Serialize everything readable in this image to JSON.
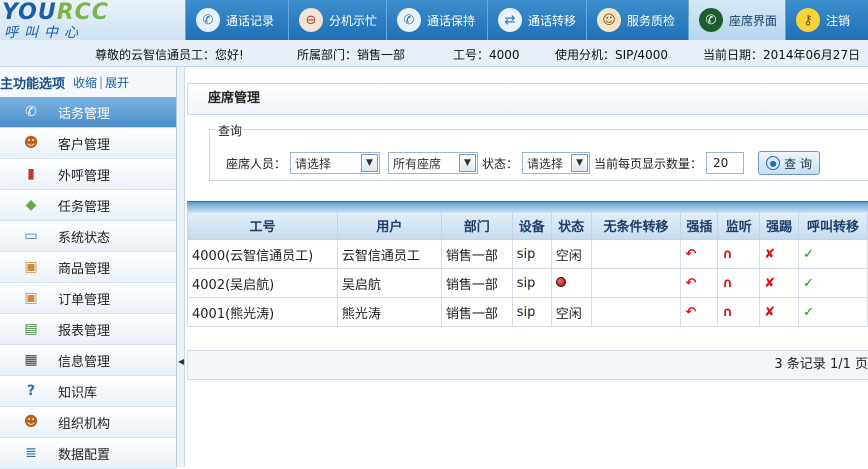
{
  "logo": {
    "text_main": "YOU",
    "text_rcc": "RCC",
    "text_sub": "呼叫中心"
  },
  "topnav": [
    {
      "label": "通话记录",
      "icon": "phone-icon"
    },
    {
      "label": "分机示忙",
      "icon": "busy-icon"
    },
    {
      "label": "通话保持",
      "icon": "hold-icon"
    },
    {
      "label": "通话转移",
      "icon": "transfer-icon"
    },
    {
      "label": "服务质检",
      "icon": "quality-icon"
    },
    {
      "label": "座席界面",
      "icon": "seat-icon"
    },
    {
      "label": "注销",
      "icon": "key-icon"
    }
  ],
  "infobar": {
    "greeting": "尊敬的云智信通员工：您好!",
    "dept": "所属部门：销售一部",
    "jobno": "工号：4000",
    "ext": "使用分机：SIP/4000",
    "date": "当前日期：2014年06月27日"
  },
  "sidebar": {
    "title": "主功能选项",
    "collapse": "收缩",
    "sep": "|",
    "expand": "展开",
    "items": [
      {
        "label": "话务管理",
        "icon": "phone-icon"
      },
      {
        "label": "客户管理",
        "icon": "customer-icon"
      },
      {
        "label": "外呼管理",
        "icon": "books-icon"
      },
      {
        "label": "任务管理",
        "icon": "task-icon"
      },
      {
        "label": "系统状态",
        "icon": "monitor-icon"
      },
      {
        "label": "商品管理",
        "icon": "box-icon"
      },
      {
        "label": "订单管理",
        "icon": "order-icon"
      },
      {
        "label": "报表管理",
        "icon": "report-icon"
      },
      {
        "label": "信息管理",
        "icon": "info-icon"
      },
      {
        "label": "知识库",
        "icon": "help-icon"
      },
      {
        "label": "组织机构",
        "icon": "users-icon"
      },
      {
        "label": "数据配置",
        "icon": "database-icon"
      }
    ]
  },
  "main": {
    "title": "座席管理",
    "query": {
      "legend": "查询",
      "agent_label": "座席人员：",
      "agent_value": "请选择",
      "seat_value": "所有座席",
      "status_label": "状态：",
      "status_value": "请选择",
      "pagesize_label": "当前每页显示数量：",
      "pagesize_value": "20",
      "search_button": "查 询"
    },
    "table": {
      "headers": [
        "工号",
        "用户",
        "部门",
        "设备",
        "状态",
        "无条件转移",
        "强插",
        "监听",
        "强踢",
        "呼叫转移"
      ],
      "rows": [
        {
          "jobno": "4000(云智信通员工)",
          "user": "云智信通员工",
          "dept": "销售一部",
          "device": "sip",
          "status": "空闲"
        },
        {
          "jobno": "4002(吴启航)",
          "user": "吴启航",
          "dept": "销售一部",
          "device": "sip",
          "status": ""
        },
        {
          "jobno": "4001(熊光涛)",
          "user": "熊光涛",
          "dept": "销售一部",
          "device": "sip",
          "status": "空闲"
        }
      ]
    },
    "pager": "3 条记录 1/1 页"
  }
}
